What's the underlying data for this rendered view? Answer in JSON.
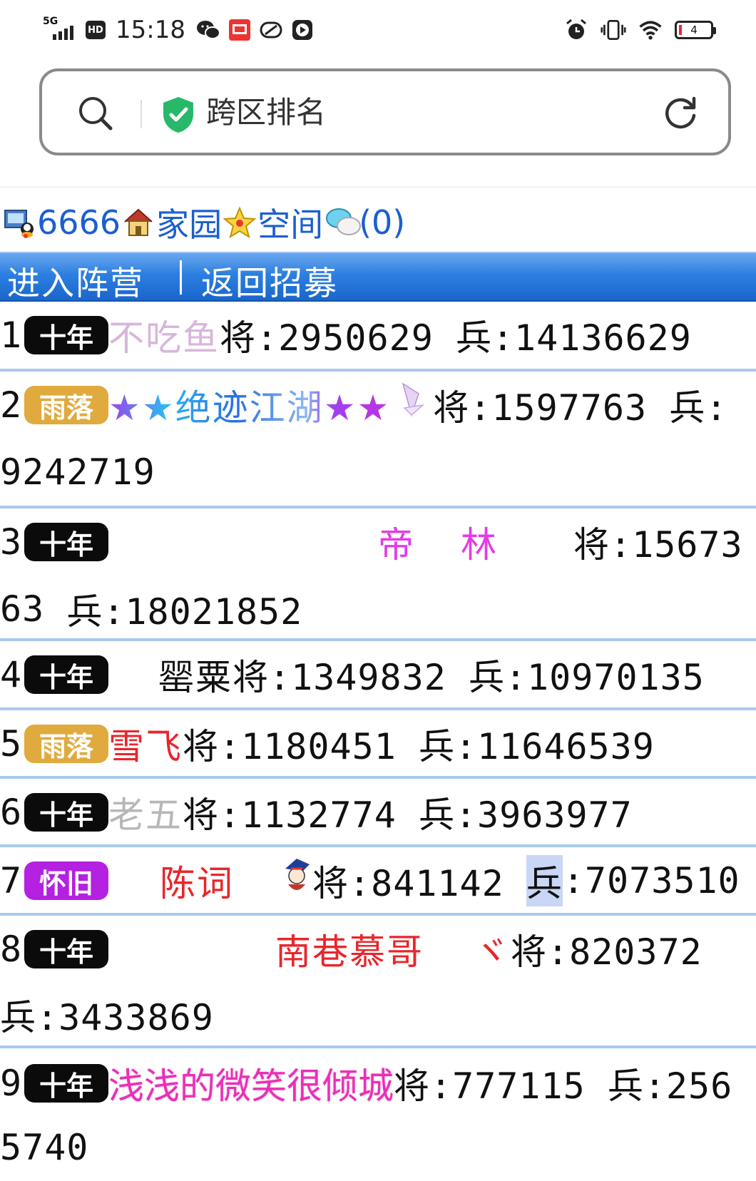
{
  "status_bar": {
    "network": "5G",
    "hd": "HD",
    "time": "15:18",
    "battery": "4"
  },
  "address_bar": {
    "title": "跨区排名"
  },
  "user_line": {
    "user_id": "6666",
    "home": "家园",
    "space": "空间",
    "messages": "(0)"
  },
  "nav": {
    "enter_camp": "进入阵营",
    "separator": "|",
    "return_recruit": "返回招募"
  },
  "rankings": [
    {
      "rank": "1",
      "badge": "十年",
      "badge_color": "#0b0b0b",
      "name": "不吃鱼",
      "name_color": "#d8b6db",
      "general": "将:2950629",
      "soldier": "兵:14136629"
    },
    {
      "rank": "2",
      "badge": "雨落",
      "badge_color": "#e0aa3e",
      "name": "★★绝迹江湖★★",
      "name_color": "#2f8fe8",
      "general": "将:1597763",
      "soldier_label": "兵:",
      "soldier_value": "9242719"
    },
    {
      "rank": "3",
      "badge": "十年",
      "badge_color": "#0b0b0b",
      "name": "帝　林",
      "name_color": "#e43ae6",
      "general_part1": "将:15673",
      "general_part2": "63",
      "soldier": "兵:18021852"
    },
    {
      "rank": "4",
      "badge": "十年",
      "badge_color": "#0b0b0b",
      "name": "罂粟",
      "name_color": "#111111",
      "general": "将:1349832",
      "soldier": "兵:10970135"
    },
    {
      "rank": "5",
      "badge": "雨落",
      "badge_color": "#e0aa3e",
      "name": "雪飞",
      "name_color": "#e8262b",
      "general": "将:1180451",
      "soldier": "兵:11646539"
    },
    {
      "rank": "6",
      "badge": "十年",
      "badge_color": "#0b0b0b",
      "name": "老五",
      "name_color": "#b7b7b7",
      "general": "将:1132774",
      "soldier": "兵:3963977"
    },
    {
      "rank": "7",
      "badge": "怀旧",
      "badge_color": "#b421e0",
      "name": "陈词",
      "name_color": "#e8262b",
      "general": "将:841142",
      "soldier_label": "兵",
      "soldier_value": ":7073510"
    },
    {
      "rank": "8",
      "badge": "十年",
      "badge_color": "#0b0b0b",
      "name": "南巷慕哥",
      "name_color": "#e8262b",
      "name_suffix": "ヾ",
      "general": "将:820372",
      "soldier": "兵:3433869"
    },
    {
      "rank": "9",
      "badge": "十年",
      "badge_color": "#0b0b0b",
      "name": "浅浅的微笑很倾城",
      "name_color": "#ea2fb6",
      "general": "将:777115",
      "soldier_part1": "兵:256",
      "soldier_part2": "5740"
    }
  ],
  "colors": {
    "nav_bar": "#2c7fe0",
    "separator": "#a9c9ee",
    "link_blue": "#1b5fd0",
    "shield_green": "#27b86a"
  },
  "icons": [
    "search-icon",
    "shield-check-icon",
    "reload-icon",
    "alarm-icon",
    "vibrate-icon",
    "wifi-icon",
    "wechat-icon",
    "app-icon",
    "leaf-icon",
    "play-icon",
    "computer-user-icon",
    "house-icon",
    "star-icon",
    "chat-bubbles-icon",
    "butterfly-icon",
    "avatar-icon"
  ]
}
